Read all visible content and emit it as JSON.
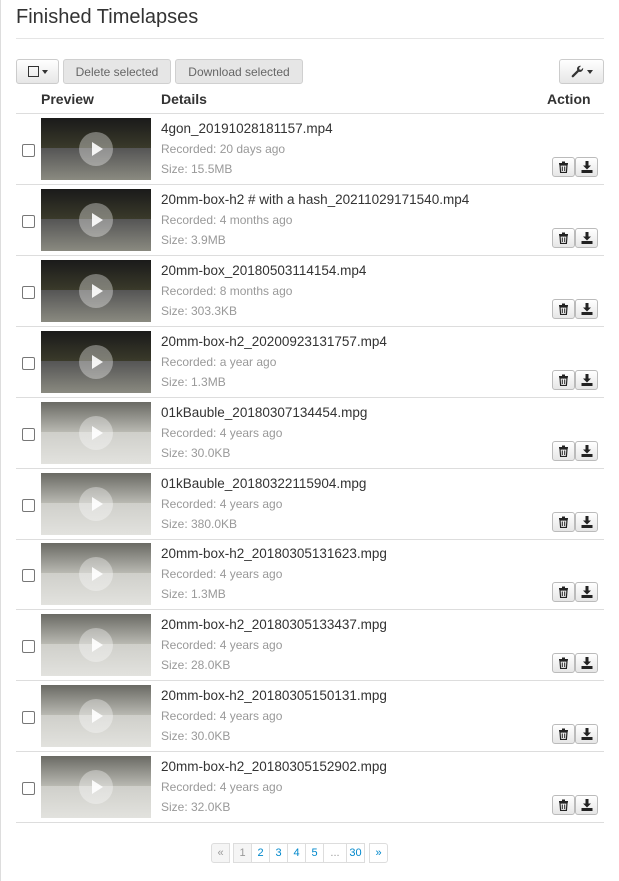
{
  "page": {
    "title": "Finished Timelapses"
  },
  "toolbar": {
    "delete_label": "Delete selected",
    "download_label": "Download selected"
  },
  "table": {
    "headers": {
      "preview": "Preview",
      "details": "Details",
      "action": "Action"
    },
    "rows": [
      {
        "name": "4gon_20191028181157.mp4",
        "recorded": "Recorded: 20 days ago",
        "size": "Size: 15.5MB"
      },
      {
        "name": "20mm-box-h2 # with a hash_20211029171540.mp4",
        "recorded": "Recorded: 4 months ago",
        "size": "Size: 3.9MB"
      },
      {
        "name": "20mm-box_20180503114154.mp4",
        "recorded": "Recorded: 8 months ago",
        "size": "Size: 303.3KB"
      },
      {
        "name": "20mm-box-h2_20200923131757.mp4",
        "recorded": "Recorded: a year ago",
        "size": "Size: 1.3MB"
      },
      {
        "name": "01kBauble_20180307134454.mpg",
        "recorded": "Recorded: 4 years ago",
        "size": "Size: 30.0KB"
      },
      {
        "name": "01kBauble_20180322115904.mpg",
        "recorded": "Recorded: 4 years ago",
        "size": "Size: 380.0KB"
      },
      {
        "name": "20mm-box-h2_20180305131623.mpg",
        "recorded": "Recorded: 4 years ago",
        "size": "Size: 1.3MB"
      },
      {
        "name": "20mm-box-h2_20180305133437.mpg",
        "recorded": "Recorded: 4 years ago",
        "size": "Size: 28.0KB"
      },
      {
        "name": "20mm-box-h2_20180305150131.mpg",
        "recorded": "Recorded: 4 years ago",
        "size": "Size: 30.0KB"
      },
      {
        "name": "20mm-box-h2_20180305152902.mpg",
        "recorded": "Recorded: 4 years ago",
        "size": "Size: 32.0KB"
      }
    ]
  },
  "pagination": {
    "prev": "«",
    "pages": [
      "1",
      "2",
      "3",
      "4",
      "5",
      "...",
      "30"
    ],
    "next": "»",
    "current": "1"
  },
  "icons": {
    "select_menu": "checkbox-dropdown-icon",
    "settings": "wrench-icon",
    "delete": "trash-icon",
    "download": "download-icon",
    "play": "play-icon"
  }
}
